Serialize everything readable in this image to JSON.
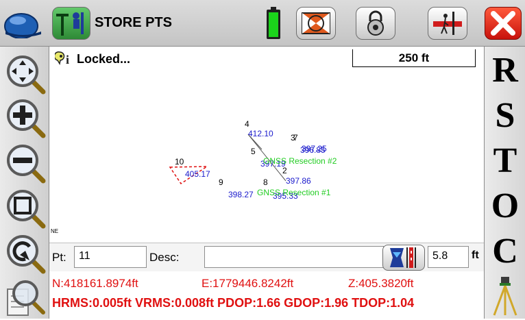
{
  "titlebar": {
    "title": "STORE PTS",
    "icons": [
      "helmet-icon",
      "gnss-rover-icon",
      "battery-icon",
      "target-icon",
      "lock-icon",
      "instrument-icon",
      "close-icon"
    ]
  },
  "map": {
    "status_label": "Locked...",
    "scale_label": "250 ft",
    "north_label": "N",
    "east_label": "E",
    "points": [
      {
        "number": "4",
        "elevation": "412.10"
      },
      {
        "number": "7",
        "elevation": "397.25"
      },
      {
        "number": "3",
        "elevation": "396.85"
      },
      {
        "number": "5",
        "elevation": "397.19"
      },
      {
        "number": "2",
        "elevation": "397.86"
      },
      {
        "number": "8",
        "elevation": "395.33"
      },
      {
        "number": "9",
        "elevation": "398.27"
      },
      {
        "number": "10",
        "elevation": "405.17"
      }
    ],
    "resection_labels": [
      "GNSS Resection #2",
      "GNSS Resection #1"
    ]
  },
  "form": {
    "pt_label": "Pt:",
    "pt_value": "11",
    "desc_label": "Desc:",
    "desc_value": "",
    "height_value": "5.8",
    "height_unit": "ft"
  },
  "status": {
    "northing": "N:418161.8974ft",
    "easting": "E:1779446.8242ft",
    "elevation": "Z:405.3820ft",
    "quality": "HRMS:0.005ft VRMS:0.008ft PDOP:1.66 GDOP:1.96 TDOP:1.04"
  },
  "right_toolbar": {
    "buttons": [
      "R",
      "S",
      "T",
      "O",
      "C"
    ]
  },
  "colors": {
    "status_red": "#e01010",
    "point_blue": "#1a1acc",
    "resection_green": "#22cc22"
  }
}
